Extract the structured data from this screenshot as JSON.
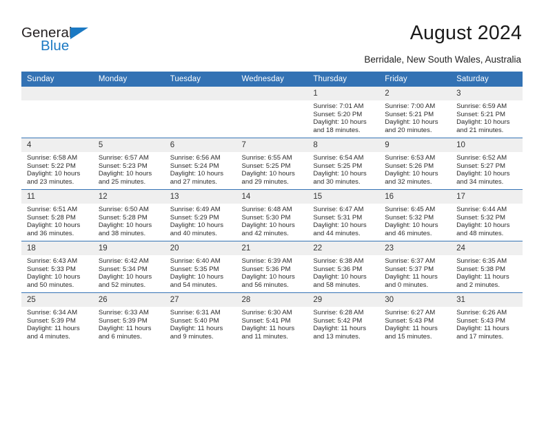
{
  "brand": {
    "name_top": "General",
    "name_bottom": "Blue",
    "accent_color": "#1b79c3"
  },
  "header": {
    "title": "August 2024",
    "subtitle": "Berridale, New South Wales, Australia",
    "header_bg_color": "#3372b4",
    "daynum_bg_color": "#efefef"
  },
  "columns": [
    "Sunday",
    "Monday",
    "Tuesday",
    "Wednesday",
    "Thursday",
    "Friday",
    "Saturday"
  ],
  "labels": {
    "sunrise": "Sunrise:",
    "sunset": "Sunset:",
    "daylight": "Daylight:"
  },
  "weeks": [
    [
      {
        "day": "",
        "empty": true
      },
      {
        "day": "",
        "empty": true
      },
      {
        "day": "",
        "empty": true
      },
      {
        "day": "",
        "empty": true
      },
      {
        "day": "1",
        "sunrise": "Sunrise: 7:01 AM",
        "sunset": "Sunset: 5:20 PM",
        "daylight": "Daylight: 10 hours and 18 minutes."
      },
      {
        "day": "2",
        "sunrise": "Sunrise: 7:00 AM",
        "sunset": "Sunset: 5:21 PM",
        "daylight": "Daylight: 10 hours and 20 minutes."
      },
      {
        "day": "3",
        "sunrise": "Sunrise: 6:59 AM",
        "sunset": "Sunset: 5:21 PM",
        "daylight": "Daylight: 10 hours and 21 minutes."
      }
    ],
    [
      {
        "day": "4",
        "sunrise": "Sunrise: 6:58 AM",
        "sunset": "Sunset: 5:22 PM",
        "daylight": "Daylight: 10 hours and 23 minutes."
      },
      {
        "day": "5",
        "sunrise": "Sunrise: 6:57 AM",
        "sunset": "Sunset: 5:23 PM",
        "daylight": "Daylight: 10 hours and 25 minutes."
      },
      {
        "day": "6",
        "sunrise": "Sunrise: 6:56 AM",
        "sunset": "Sunset: 5:24 PM",
        "daylight": "Daylight: 10 hours and 27 minutes."
      },
      {
        "day": "7",
        "sunrise": "Sunrise: 6:55 AM",
        "sunset": "Sunset: 5:25 PM",
        "daylight": "Daylight: 10 hours and 29 minutes."
      },
      {
        "day": "8",
        "sunrise": "Sunrise: 6:54 AM",
        "sunset": "Sunset: 5:25 PM",
        "daylight": "Daylight: 10 hours and 30 minutes."
      },
      {
        "day": "9",
        "sunrise": "Sunrise: 6:53 AM",
        "sunset": "Sunset: 5:26 PM",
        "daylight": "Daylight: 10 hours and 32 minutes."
      },
      {
        "day": "10",
        "sunrise": "Sunrise: 6:52 AM",
        "sunset": "Sunset: 5:27 PM",
        "daylight": "Daylight: 10 hours and 34 minutes."
      }
    ],
    [
      {
        "day": "11",
        "sunrise": "Sunrise: 6:51 AM",
        "sunset": "Sunset: 5:28 PM",
        "daylight": "Daylight: 10 hours and 36 minutes."
      },
      {
        "day": "12",
        "sunrise": "Sunrise: 6:50 AM",
        "sunset": "Sunset: 5:28 PM",
        "daylight": "Daylight: 10 hours and 38 minutes."
      },
      {
        "day": "13",
        "sunrise": "Sunrise: 6:49 AM",
        "sunset": "Sunset: 5:29 PM",
        "daylight": "Daylight: 10 hours and 40 minutes."
      },
      {
        "day": "14",
        "sunrise": "Sunrise: 6:48 AM",
        "sunset": "Sunset: 5:30 PM",
        "daylight": "Daylight: 10 hours and 42 minutes."
      },
      {
        "day": "15",
        "sunrise": "Sunrise: 6:47 AM",
        "sunset": "Sunset: 5:31 PM",
        "daylight": "Daylight: 10 hours and 44 minutes."
      },
      {
        "day": "16",
        "sunrise": "Sunrise: 6:45 AM",
        "sunset": "Sunset: 5:32 PM",
        "daylight": "Daylight: 10 hours and 46 minutes."
      },
      {
        "day": "17",
        "sunrise": "Sunrise: 6:44 AM",
        "sunset": "Sunset: 5:32 PM",
        "daylight": "Daylight: 10 hours and 48 minutes."
      }
    ],
    [
      {
        "day": "18",
        "sunrise": "Sunrise: 6:43 AM",
        "sunset": "Sunset: 5:33 PM",
        "daylight": "Daylight: 10 hours and 50 minutes."
      },
      {
        "day": "19",
        "sunrise": "Sunrise: 6:42 AM",
        "sunset": "Sunset: 5:34 PM",
        "daylight": "Daylight: 10 hours and 52 minutes."
      },
      {
        "day": "20",
        "sunrise": "Sunrise: 6:40 AM",
        "sunset": "Sunset: 5:35 PM",
        "daylight": "Daylight: 10 hours and 54 minutes."
      },
      {
        "day": "21",
        "sunrise": "Sunrise: 6:39 AM",
        "sunset": "Sunset: 5:36 PM",
        "daylight": "Daylight: 10 hours and 56 minutes."
      },
      {
        "day": "22",
        "sunrise": "Sunrise: 6:38 AM",
        "sunset": "Sunset: 5:36 PM",
        "daylight": "Daylight: 10 hours and 58 minutes."
      },
      {
        "day": "23",
        "sunrise": "Sunrise: 6:37 AM",
        "sunset": "Sunset: 5:37 PM",
        "daylight": "Daylight: 11 hours and 0 minutes."
      },
      {
        "day": "24",
        "sunrise": "Sunrise: 6:35 AM",
        "sunset": "Sunset: 5:38 PM",
        "daylight": "Daylight: 11 hours and 2 minutes."
      }
    ],
    [
      {
        "day": "25",
        "sunrise": "Sunrise: 6:34 AM",
        "sunset": "Sunset: 5:39 PM",
        "daylight": "Daylight: 11 hours and 4 minutes."
      },
      {
        "day": "26",
        "sunrise": "Sunrise: 6:33 AM",
        "sunset": "Sunset: 5:39 PM",
        "daylight": "Daylight: 11 hours and 6 minutes."
      },
      {
        "day": "27",
        "sunrise": "Sunrise: 6:31 AM",
        "sunset": "Sunset: 5:40 PM",
        "daylight": "Daylight: 11 hours and 9 minutes."
      },
      {
        "day": "28",
        "sunrise": "Sunrise: 6:30 AM",
        "sunset": "Sunset: 5:41 PM",
        "daylight": "Daylight: 11 hours and 11 minutes."
      },
      {
        "day": "29",
        "sunrise": "Sunrise: 6:28 AM",
        "sunset": "Sunset: 5:42 PM",
        "daylight": "Daylight: 11 hours and 13 minutes."
      },
      {
        "day": "30",
        "sunrise": "Sunrise: 6:27 AM",
        "sunset": "Sunset: 5:43 PM",
        "daylight": "Daylight: 11 hours and 15 minutes."
      },
      {
        "day": "31",
        "sunrise": "Sunrise: 6:26 AM",
        "sunset": "Sunset: 5:43 PM",
        "daylight": "Daylight: 11 hours and 17 minutes."
      }
    ]
  ]
}
